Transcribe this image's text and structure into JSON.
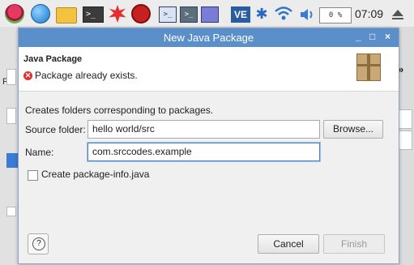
{
  "taskbar": {
    "cpu_label": "0 %",
    "clock": "07:09",
    "terminal_glyph": ">_",
    "window_glyph": ">_",
    "ve_label": "VE",
    "bt_glyph": "✱"
  },
  "background": {
    "menu_fragment": "Fil"
  },
  "dialog": {
    "title": "New Java Package",
    "minimize": "_",
    "maximize": "□",
    "close": "×",
    "header_title": "Java Package",
    "error_message": "Package already exists.",
    "description": "Creates folders corresponding to packages.",
    "source_folder_label": "Source folder:",
    "source_folder_value": "hello world/src",
    "browse_label": "Browse...",
    "name_label": "Name:",
    "name_value": "com.srccodes.example",
    "create_info_label": "Create package-info.java",
    "help_glyph": "?",
    "cancel_label": "Cancel",
    "finish_label": "Finish"
  }
}
